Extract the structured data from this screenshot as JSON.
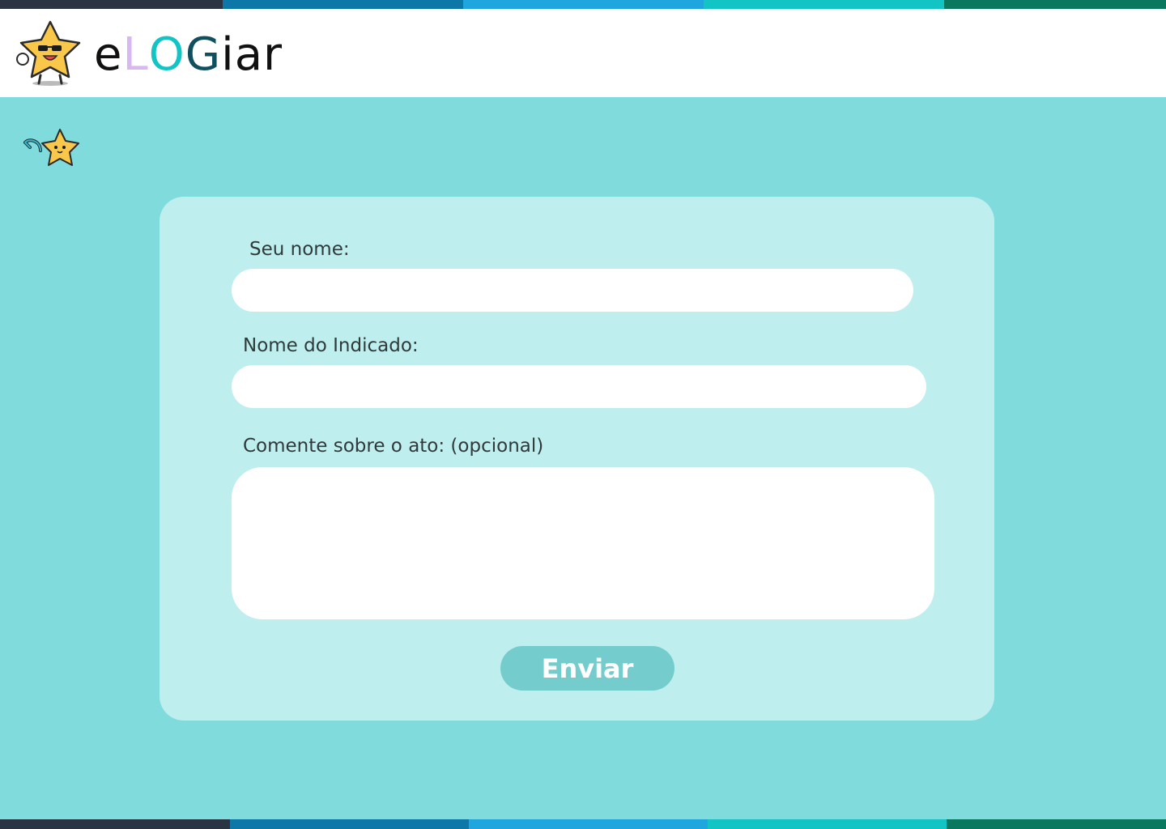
{
  "stripe_colors": [
    "#2b3442",
    "#0d78a8",
    "#1fa6df",
    "#12c4c4",
    "#0a785e"
  ],
  "brand": {
    "parts": [
      {
        "text": "e",
        "color": "#111111"
      },
      {
        "text": "L",
        "color": "#d9b8f2"
      },
      {
        "text": "O",
        "color": "#12c4c4"
      },
      {
        "text": "G",
        "color": "#0f4f5f"
      },
      {
        "text": "iar",
        "color": "#111111"
      }
    ]
  },
  "icons": {
    "logo": "star-mascot-sunglasses-icon",
    "back": "back-arrow-star-icon"
  },
  "form": {
    "name_label": "Seu nome:",
    "name_value": "",
    "nominee_label": "Nome do Indicado:",
    "nominee_value": "",
    "comment_label": "Comente sobre o ato: (opcional)",
    "comment_value": "",
    "submit_label": "Enviar"
  },
  "colors": {
    "page_bg": "#80dcdc",
    "card_bg": "#bfeeee",
    "button_bg": "#74cccc"
  }
}
